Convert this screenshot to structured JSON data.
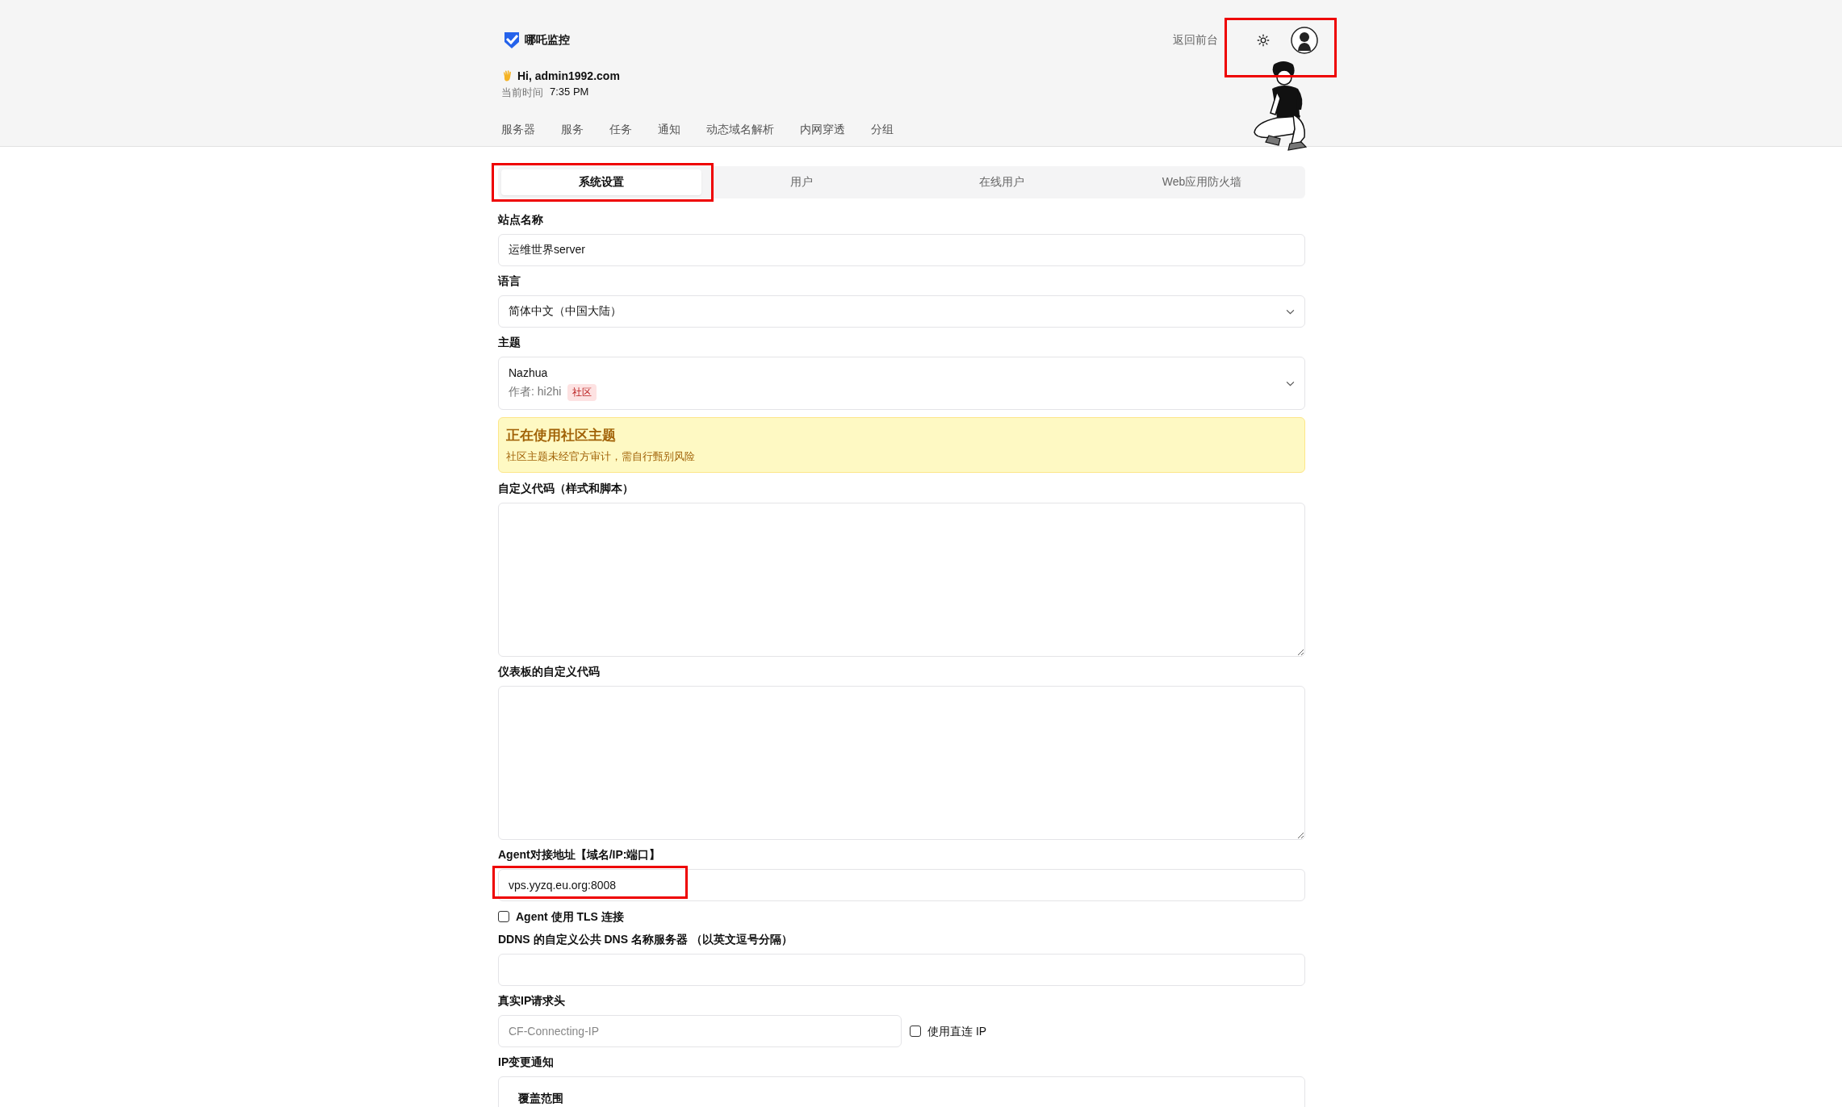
{
  "header": {
    "brand": "哪吒监控",
    "back_link": "返回前台",
    "greeting": "Hi, admin1992.com",
    "time_label": "当前时间",
    "time": "7:35 PM"
  },
  "nav": [
    "服务器",
    "服务",
    "任务",
    "通知",
    "动态域名解析",
    "内网穿透",
    "分组"
  ],
  "tabs": [
    {
      "label": "系统设置",
      "selected": true
    },
    {
      "label": "用户",
      "selected": false
    },
    {
      "label": "在线用户",
      "selected": false
    },
    {
      "label": "Web应用防火墙",
      "selected": false
    }
  ],
  "form": [
    {
      "kind": "input",
      "label": "站点名称",
      "value": "运维世界server"
    },
    {
      "kind": "select",
      "label": "语言",
      "value": "简体中文（中国大陆）"
    },
    {
      "kind": "theme",
      "label": "主题",
      "name": "Nazhua",
      "author": "作者: hi2hi",
      "tag": "社区"
    },
    {
      "kind": "alert",
      "title": "正在使用社区主题",
      "text": "社区主题未经官方审计，需自行甄别风险"
    },
    {
      "kind": "textarea",
      "label": "自定义代码（样式和脚本）"
    },
    {
      "kind": "textarea",
      "label": "仪表板的自定义代码"
    },
    {
      "kind": "input",
      "label": "Agent对接地址【域名/IP:端口】",
      "value": "vps.yyzq.eu.org:8008"
    },
    {
      "kind": "checkbox",
      "label": "Agent 使用 TLS 连接",
      "checked": false
    },
    {
      "kind": "input",
      "label": "DDNS 的自定义公共 DNS 名称服务器 （以英文逗号分隔）"
    },
    {
      "kind": "input-check",
      "label": "真实IP请求头",
      "placeholder": "CF-Connecting-IP",
      "check_label": "使用直连 IP",
      "checked": false
    },
    {
      "kind": "card",
      "label": "IP变更通知",
      "title": "覆盖范围"
    }
  ]
}
